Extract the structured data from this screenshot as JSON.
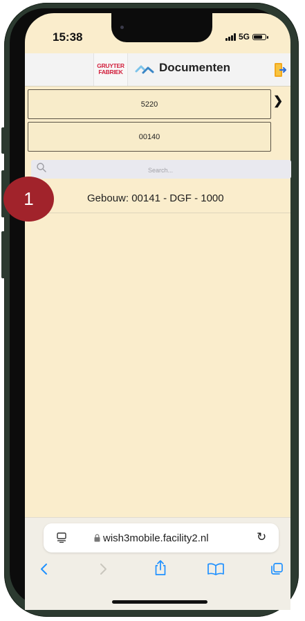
{
  "status_bar": {
    "time": "15:38",
    "network": "5G"
  },
  "app_header": {
    "logo_text_line1": "GRUYTER",
    "logo_text_line2": "FABRIEK",
    "title": "Documenten",
    "logo_icon": "arrows-logo-icon",
    "exit_icon": "exit-door-icon"
  },
  "selectors": [
    {
      "value": "5220"
    },
    {
      "value": "00140"
    }
  ],
  "search": {
    "placeholder": "Search..."
  },
  "list": {
    "items": [
      {
        "label": "Gebouw: 00141 - DGF - 1000"
      }
    ]
  },
  "annotation": {
    "marker": "1",
    "color": "#a1232b"
  },
  "browser": {
    "url": "wish3mobile.facility2.nl"
  },
  "colors": {
    "background": "#faedcc",
    "accent": "#1e90ff",
    "marker": "#a1232b"
  }
}
